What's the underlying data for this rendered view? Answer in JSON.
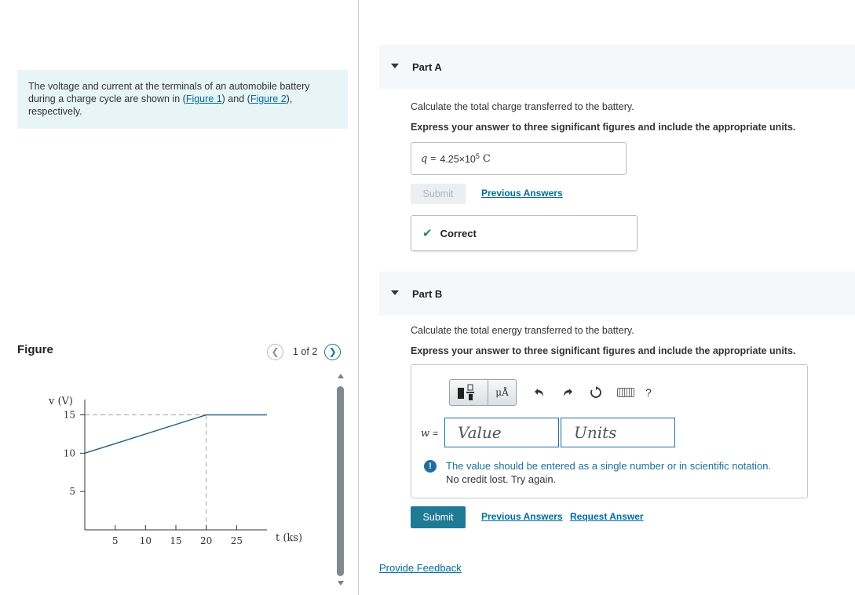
{
  "intro": {
    "pre": "The voltage and current at the terminals of an automobile battery during a charge cycle are shown in (",
    "link1": "Figure 1",
    "mid": ") and (",
    "link2": "Figure 2",
    "post": "), respectively."
  },
  "figure": {
    "title": "Figure",
    "counter": "1 of 2",
    "prev_icon": "chevron-left-icon",
    "next_icon": "chevron-right-icon"
  },
  "chart_data": {
    "type": "line",
    "ylabel": "v (V)",
    "xlabel": "t (ks)",
    "x_ticks": [
      5,
      10,
      15,
      20,
      25
    ],
    "y_ticks": [
      5,
      10,
      15
    ],
    "xlim": [
      0,
      30
    ],
    "ylim": [
      0,
      17
    ],
    "series": [
      {
        "x": [
          0,
          20,
          30
        ],
        "y": [
          10,
          15,
          15
        ]
      }
    ],
    "guides": {
      "horizontal_at_y": 15,
      "vertical_at_x": 20,
      "style": "dashed"
    },
    "colors": {
      "series": "#1f5f7a",
      "guide": "#9aa4ac",
      "axis": "#333333"
    }
  },
  "partA": {
    "title": "Part A",
    "question": "Calculate the total charge transferred to the battery.",
    "instruction": "Express your answer to three significant figures and include the appropriate units.",
    "answer_var": "q",
    "answer_eq": "=",
    "answer_mantissa": "4.25×10",
    "answer_exp": "5",
    "answer_unit": "C",
    "submit_label": "Submit",
    "previous_answers": "Previous Answers",
    "feedback_icon": "check-icon",
    "feedback": "Correct"
  },
  "partB": {
    "title": "Part B",
    "question": "Calculate the total energy transferred to the battery.",
    "instruction": "Express your answer to three significant figures and include the appropriate units.",
    "answer_var": "w",
    "answer_eq": "=",
    "value_placeholder": "Value",
    "units_placeholder": "Units",
    "toolbar": {
      "units_label": "μÅ",
      "icons": [
        "templates-icon",
        "units-icon",
        "undo-icon",
        "redo-icon",
        "reset-icon",
        "keyboard-icon",
        "help-icon"
      ],
      "help_label": "?"
    },
    "warning_icon": "exclamation-icon",
    "warning_mark": "!",
    "warning": "The value should be entered as a single number or in scientific notation.",
    "warning_sub": "No credit lost. Try again.",
    "submit_label": "Submit",
    "previous_answers": "Previous Answers",
    "request_answer": "Request Answer"
  },
  "footer": {
    "provide_feedback": "Provide Feedback"
  },
  "colors": {
    "accent": "#1f7a94",
    "link": "#006b9e",
    "intro_bg": "#e7f5f7",
    "correct": "#2e8540",
    "warning": "#1f6f9a"
  }
}
